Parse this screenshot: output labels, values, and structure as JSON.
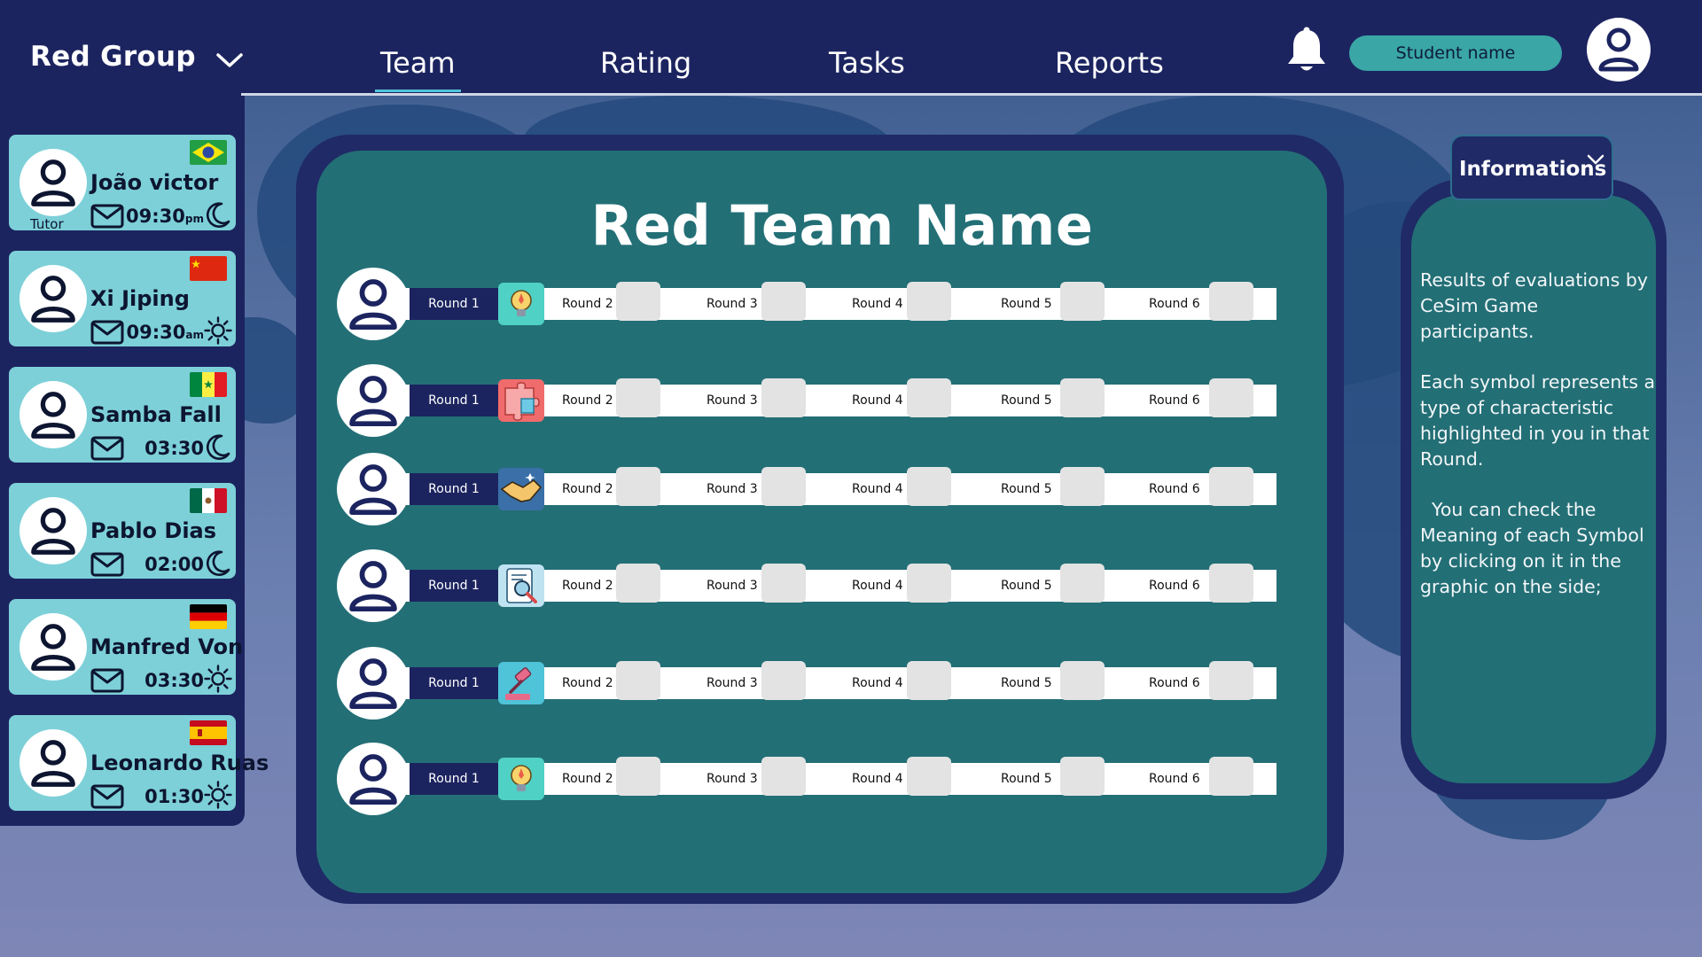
{
  "header": {
    "group_label": "Red Group",
    "nav": [
      "Team",
      "Rating",
      "Tasks",
      "Reports"
    ],
    "active_tab": "Team",
    "student_button": "Student name"
  },
  "members": [
    {
      "name": "João victor",
      "time": "09:30",
      "suffix": "pm",
      "role": "Tutor",
      "flag": "brazil",
      "day_icon": "moon-icon"
    },
    {
      "name": "Xi Jiping",
      "time": "09:30",
      "suffix": "am",
      "role": "",
      "flag": "china",
      "day_icon": "sun-icon"
    },
    {
      "name": "Samba Fall",
      "time": "03:30",
      "suffix": "",
      "role": "",
      "flag": "senegal",
      "day_icon": "moon-icon"
    },
    {
      "name": "Pablo Dias",
      "time": "02:00",
      "suffix": "",
      "role": "",
      "flag": "mexico",
      "day_icon": "moon-icon"
    },
    {
      "name": "Manfred Von",
      "time": "03:30",
      "suffix": "",
      "role": "",
      "flag": "germany",
      "day_icon": "sun-icon"
    },
    {
      "name": "Leonardo Ruas",
      "time": "01:30",
      "suffix": "",
      "role": "",
      "flag": "spain",
      "day_icon": "sun-icon"
    }
  ],
  "main": {
    "title": "Red Team Name",
    "rounds": [
      "Round 1",
      "Round 2",
      "Round 3",
      "Round 4",
      "Round 5",
      "Round 6"
    ],
    "rows": [
      {
        "symbol": "lightbulb-rocket-icon",
        "symbol_color": "#4fd1c5"
      },
      {
        "symbol": "puzzle-icon",
        "symbol_color": "#f06b6b"
      },
      {
        "symbol": "handshake-icon",
        "symbol_color": "#3a6fa8"
      },
      {
        "symbol": "document-search-icon",
        "symbol_color": "#bfe3f0"
      },
      {
        "symbol": "gavel-icon",
        "symbol_color": "#4fc3d8"
      },
      {
        "symbol": "lightbulb-rocket-icon",
        "symbol_color": "#4fd1c5"
      }
    ]
  },
  "info": {
    "tab_label": "Informations",
    "paragraphs": [
      "Results of evaluations by CeSim Game participants.",
      "Each symbol represents a type of characteristic highlighted in you in that Round.",
      "  You can check the Meaning of each Symbol by clicking on it in the graphic on the side;"
    ]
  },
  "colors": {
    "navy": "#1c2460",
    "teal": "#236f76",
    "card_light": "#7dd0d8",
    "accent": "#3aa6a6"
  }
}
